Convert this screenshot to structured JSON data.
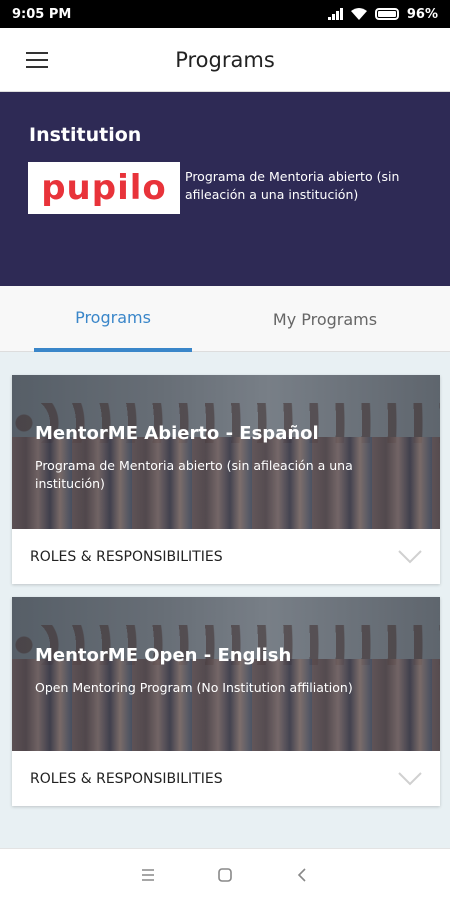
{
  "status_bar": {
    "time": "9:05 PM",
    "battery": "96%"
  },
  "app_bar": {
    "title": "Programs",
    "menu_icon": "hamburger-menu-icon"
  },
  "institution": {
    "label": "Institution",
    "logo_text": "pupilo",
    "description": "Programa de Mentoria abierto (sin afileación a una institución)"
  },
  "tabs": [
    {
      "label": "Programs",
      "active": true
    },
    {
      "label": "My Programs",
      "active": false
    }
  ],
  "programs": [
    {
      "title": "MentorME Abierto - Español",
      "subtitle": "Programa de Mentoria abierto (sin afileación a una institución)",
      "roles_label": "ROLES & RESPONSIBILITIES"
    },
    {
      "title": "MentorME Open - English",
      "subtitle": "Open Mentoring Program (No Institution affiliation)",
      "roles_label": "ROLES & RESPONSIBILITIES"
    }
  ],
  "colors": {
    "header_bg": "#2e2a55",
    "accent": "#3a86c9",
    "logo_red": "#e8333a"
  },
  "nav_bar": {
    "icons": [
      "recents-icon",
      "home-icon",
      "back-icon"
    ]
  }
}
